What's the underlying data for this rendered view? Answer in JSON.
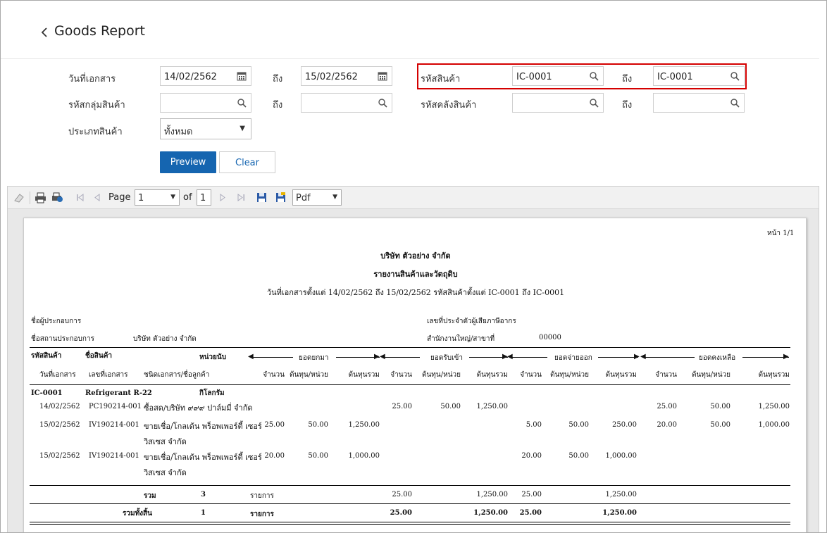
{
  "page": {
    "title": "Goods Report"
  },
  "filters": {
    "doc_date_label": "วันที่เอกสาร",
    "doc_date_from": "14/02/2562",
    "to_label": "ถึง",
    "doc_date_to": "15/02/2562",
    "product_code_label": "รหัสสินค้า",
    "product_code_from": "IC-0001",
    "product_code_to": "IC-0001",
    "product_group_label": "รหัสกลุ่มสินค้า",
    "product_group_from": "",
    "product_group_to": "",
    "warehouse_label": "รหัสคลังสินค้า",
    "warehouse_from": "",
    "warehouse_to": "",
    "product_type_label": "ประเภทสินค้า",
    "product_type_value": "ทั้งหมด",
    "preview_label": "Preview",
    "clear_label": "Clear"
  },
  "toolbar": {
    "page_label": "Page",
    "page_value": "1",
    "of_label": "of",
    "total_pages": "1",
    "format_value": "Pdf"
  },
  "report": {
    "page_no": "หน้า 1/1",
    "company": "บริษัท ตัวอย่าง จำกัด",
    "report_title": "รายงานสินค้าและวัตถุดิบ",
    "criteria": "วันที่เอกสารตั้งแต่ 14/02/2562 ถึง 15/02/2562 รหัสสินค้าตั้งแต่ IC-0001 ถึง IC-0001",
    "operator_name_label": "ชื่อผู้ประกอบการ",
    "operator_place_label": "ชื่อสถานประกอบการ",
    "operator_place_value": "บริษัท ตัวอย่าง จำกัด",
    "tax_id_label": "เลขที่ประจำตัวผู้เสียภาษีอากร",
    "branch_label": "สำนักงานใหญ่/สาขาที่",
    "branch_value": "00000",
    "h_code": "รหัสสินค้า",
    "h_name": "ชื่อสินค้า",
    "h_unit": "หน่วยนับ",
    "h_date": "วันที่เอกสาร",
    "h_docno": "เลขที่เอกสาร",
    "h_doctype": "ชนิดเอกสาร/ชื่อลูกค้า",
    "g_opening": "ยอดยกมา",
    "g_receive": "ยอดรับเข้า",
    "g_issue": "ยอดจ่ายออก",
    "g_balance": "ยอดคงเหลือ",
    "c_qty": "จำนวน",
    "c_unitcost": "ต้นทุน/หน่วย",
    "c_total": "ต้นทุนรวม",
    "product": {
      "code": "IC-0001",
      "name": "Refrigerant R-22",
      "unit": "กิโลกรัม"
    },
    "rows": [
      {
        "date": "14/02/2562",
        "doc": "PC190214-001",
        "desc1": "ซื้อสด/บริษัท ๙๙๙ ปาล์มมี่ จำกัด",
        "desc2": "",
        "op_q": "",
        "op_u": "",
        "op_t": "",
        "rc_q": "25.00",
        "rc_u": "50.00",
        "rc_t": "1,250.00",
        "is_q": "",
        "is_u": "",
        "is_t": "",
        "bl_q": "25.00",
        "bl_u": "50.00",
        "bl_t": "1,250.00"
      },
      {
        "date": "15/02/2562",
        "doc": "IV190214-001",
        "desc1": "ขายเชื่อ/โกลเด้น พร็อพเพอร์ตี้ เซอร์",
        "desc2": "วิสเซส จำกัด",
        "op_q": "25.00",
        "op_u": "50.00",
        "op_t": "1,250.00",
        "rc_q": "",
        "rc_u": "",
        "rc_t": "",
        "is_q": "5.00",
        "is_u": "50.00",
        "is_t": "250.00",
        "bl_q": "20.00",
        "bl_u": "50.00",
        "bl_t": "1,000.00"
      },
      {
        "date": "15/02/2562",
        "doc": "IV190214-001",
        "desc1": "ขายเชื่อ/โกลเด้น พร็อพเพอร์ตี้ เซอร์",
        "desc2": "วิสเซส จำกัด",
        "op_q": "20.00",
        "op_u": "50.00",
        "op_t": "1,000.00",
        "rc_q": "",
        "rc_u": "",
        "rc_t": "",
        "is_q": "20.00",
        "is_u": "50.00",
        "is_t": "1,000.00",
        "bl_q": "",
        "bl_u": "",
        "bl_t": ""
      }
    ],
    "subtotal": {
      "label": "รวม",
      "count": "3",
      "unit": "รายการ",
      "rc_q": "25.00",
      "rc_t": "1,250.00",
      "is_q": "25.00",
      "is_t": "1,250.00"
    },
    "grandtotal": {
      "label": "รวมทั้งสิ้น",
      "count": "1",
      "unit": "รายการ",
      "rc_q": "25.00",
      "rc_t": "1,250.00",
      "is_q": "25.00",
      "is_t": "1,250.00"
    }
  }
}
